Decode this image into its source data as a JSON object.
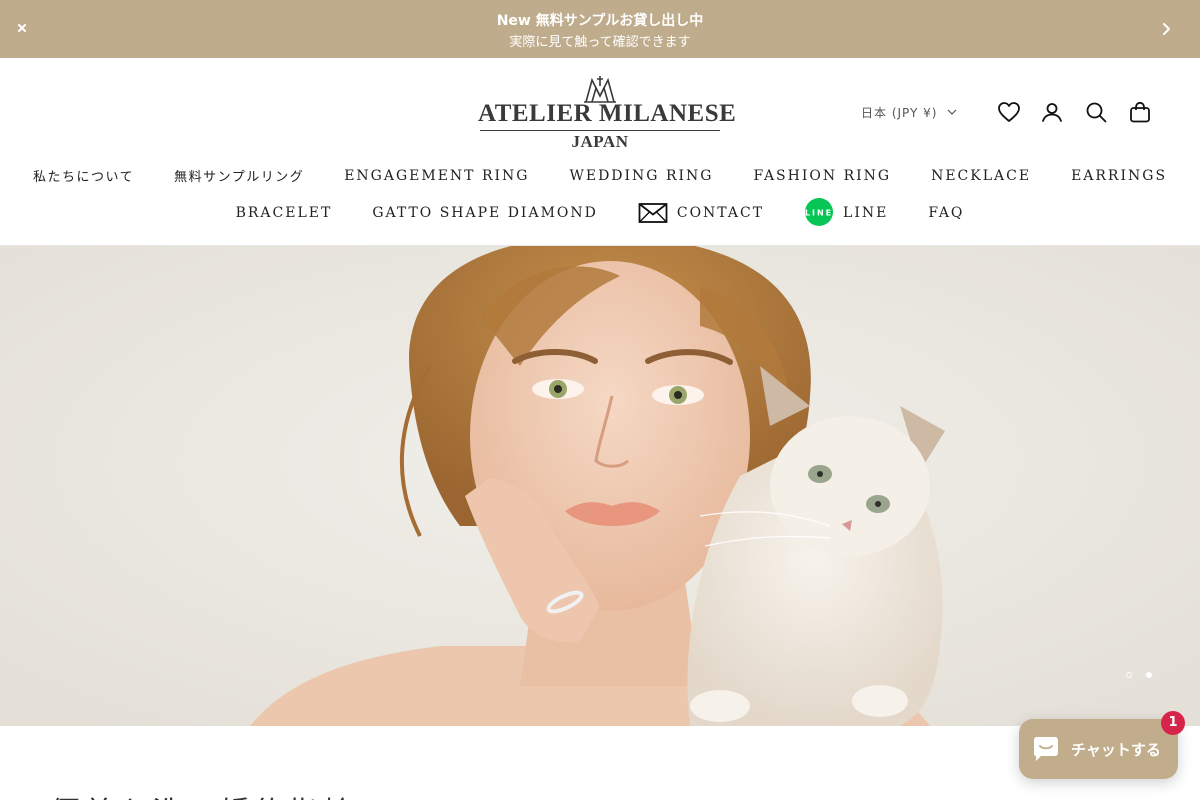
{
  "announcement": {
    "title": "New 無料サンプルお貸し出し中",
    "subtitle": "実際に見て触って確認できます",
    "close_icon": "close-icon",
    "next_icon": "chevron-right-icon"
  },
  "header": {
    "logo": {
      "name": "ATELIER MILANESE",
      "sub": "JAPAN"
    },
    "locale": "日本 (JPY ¥)",
    "icons": [
      "heart-icon",
      "account-icon",
      "search-icon",
      "bag-icon"
    ]
  },
  "nav": {
    "row1": [
      "私たちについて",
      "無料サンプルリング",
      "ENGAGEMENT RING",
      "WEDDING RING",
      "FASHION RING",
      "NECKLACE",
      "EARRINGS"
    ],
    "row2": [
      "BRACELET",
      "GATTO SHAPE DIAMOND",
      "CONTACT",
      "LINE",
      "FAQ"
    ],
    "line_badge_text": "LINE"
  },
  "hero": {
    "slide_count": 2,
    "active_slide": 2,
    "colors": {
      "backdrop": "#eae8e3",
      "hair": "#b7803f",
      "skin": "#efcdb6",
      "cat_fur": "#f2ece3"
    }
  },
  "section": {
    "heading_partial": "優美な洗い婚約指輪"
  },
  "chat": {
    "label": "チャットする",
    "badge": "1"
  },
  "colors": {
    "announcement_bg": "#bfac8d",
    "chat_bg": "#c1ad8c",
    "badge_red": "#d7244a",
    "line_green": "#06c755"
  }
}
